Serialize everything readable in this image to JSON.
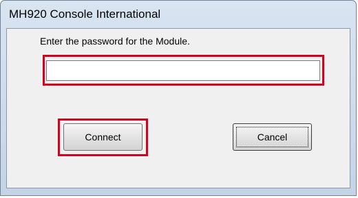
{
  "window": {
    "title": "MH920 Console International"
  },
  "dialog": {
    "prompt": "Enter the password for the Module.",
    "password": {
      "value": "",
      "placeholder": ""
    },
    "buttons": {
      "connect_label": "Connect",
      "cancel_label": "Cancel"
    }
  },
  "colors": {
    "highlight": "#d6001c",
    "client_background": "#f0f0f0"
  }
}
